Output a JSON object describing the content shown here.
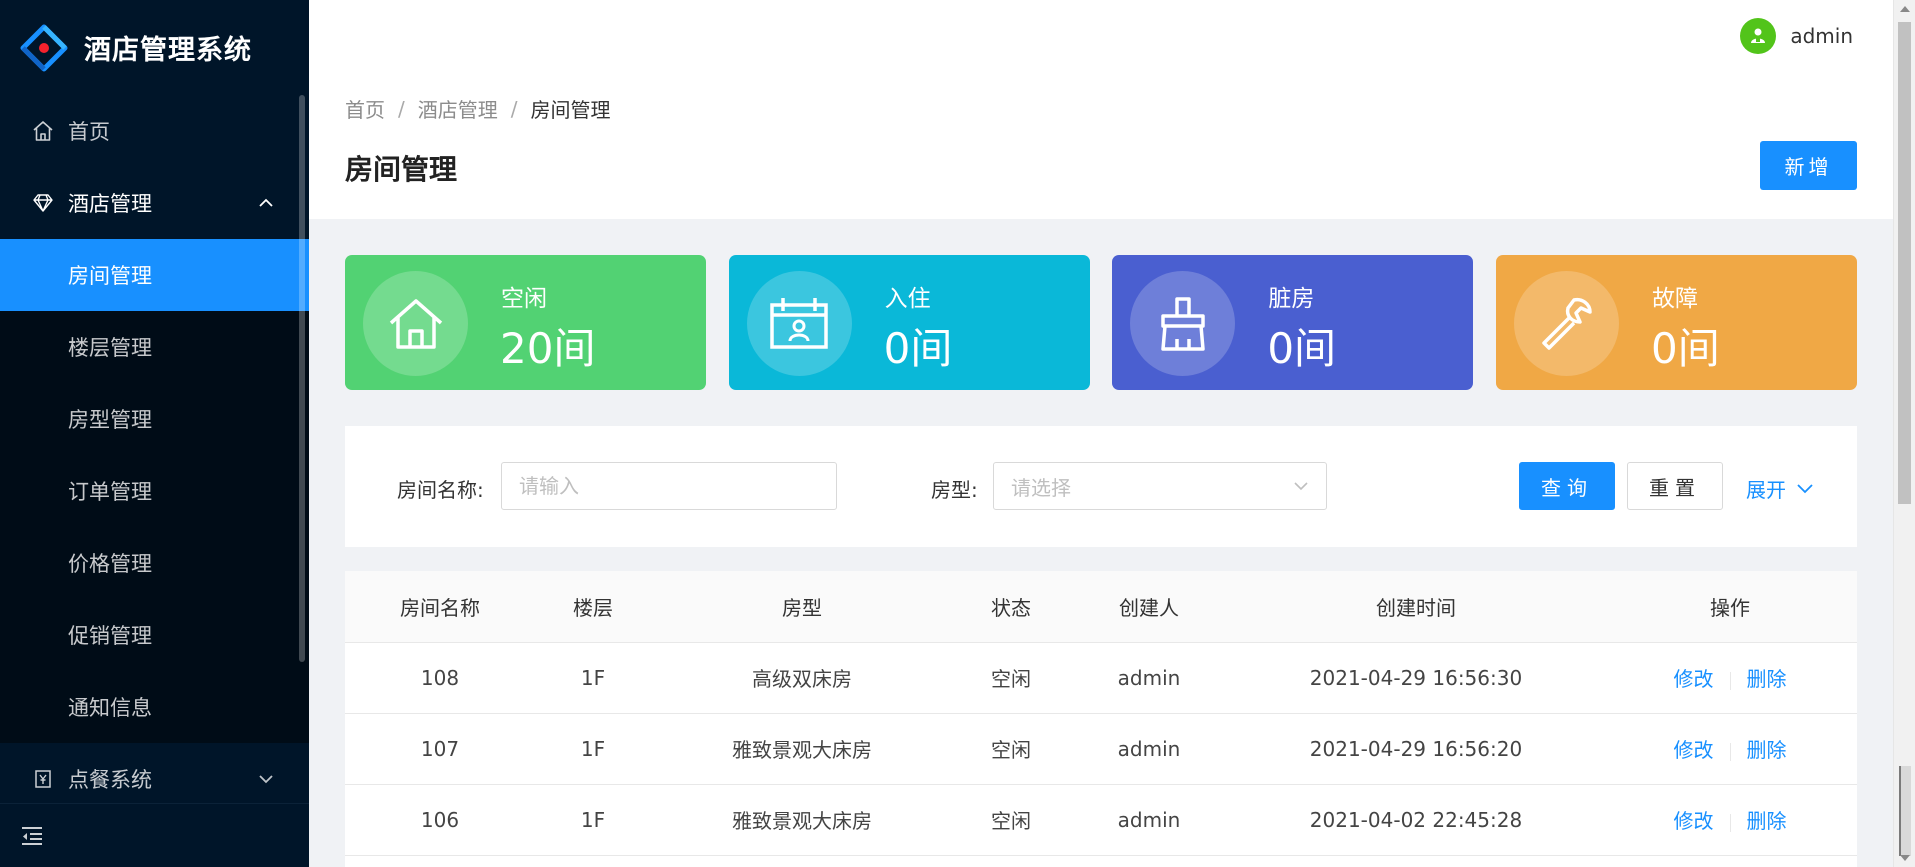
{
  "app": {
    "title": "酒店管理系统"
  },
  "colors": {
    "sidebar": "#001529",
    "accent": "#1890ff",
    "idle": "#52d273",
    "checkin": "#0ab8d8",
    "dirty": "#4a5fd0",
    "fault": "#f0a845"
  },
  "sidebar": {
    "home": {
      "label": "首页",
      "icon": "home-icon"
    },
    "hotel": {
      "label": "酒店管理",
      "icon": "diamond-icon"
    },
    "submenu": [
      {
        "label": "房间管理",
        "active": true
      },
      {
        "label": "楼层管理"
      },
      {
        "label": "房型管理"
      },
      {
        "label": "订单管理"
      },
      {
        "label": "价格管理"
      },
      {
        "label": "促销管理"
      },
      {
        "label": "通知信息"
      }
    ],
    "dining": {
      "label": "点餐系统",
      "icon": "yen-icon"
    }
  },
  "header": {
    "username": "admin"
  },
  "breadcrumb": {
    "home": "首页",
    "section": "酒店管理",
    "current": "房间管理",
    "sep": "/"
  },
  "page": {
    "title": "房间管理",
    "add_label": "新增"
  },
  "stats": [
    {
      "label": "空闲",
      "value": "20间",
      "icon": "house-icon"
    },
    {
      "label": "入住",
      "value": "0间",
      "icon": "calendar-person-icon"
    },
    {
      "label": "脏房",
      "value": "0间",
      "icon": "broom-icon"
    },
    {
      "label": "故障",
      "value": "0间",
      "icon": "wrench-icon"
    }
  ],
  "filter": {
    "room_name_label": "房间名称:",
    "room_name_placeholder": "请输入",
    "room_type_label": "房型:",
    "room_type_placeholder": "请选择",
    "query_label": "查询",
    "reset_label": "重置",
    "expand_label": "展开"
  },
  "table": {
    "columns": [
      "房间名称",
      "楼层",
      "房型",
      "状态",
      "创建人",
      "创建时间",
      "操作"
    ],
    "rows": [
      {
        "name": "108",
        "floor": "1F",
        "type": "高级双床房",
        "status": "空闲",
        "creator": "admin",
        "created": "2021-04-29 16:56:30"
      },
      {
        "name": "107",
        "floor": "1F",
        "type": "雅致景观大床房",
        "status": "空闲",
        "creator": "admin",
        "created": "2021-04-29 16:56:20"
      },
      {
        "name": "106",
        "floor": "1F",
        "type": "雅致景观大床房",
        "status": "空闲",
        "creator": "admin",
        "created": "2021-04-02 22:45:28"
      }
    ],
    "edit_label": "修改",
    "delete_label": "删除"
  }
}
